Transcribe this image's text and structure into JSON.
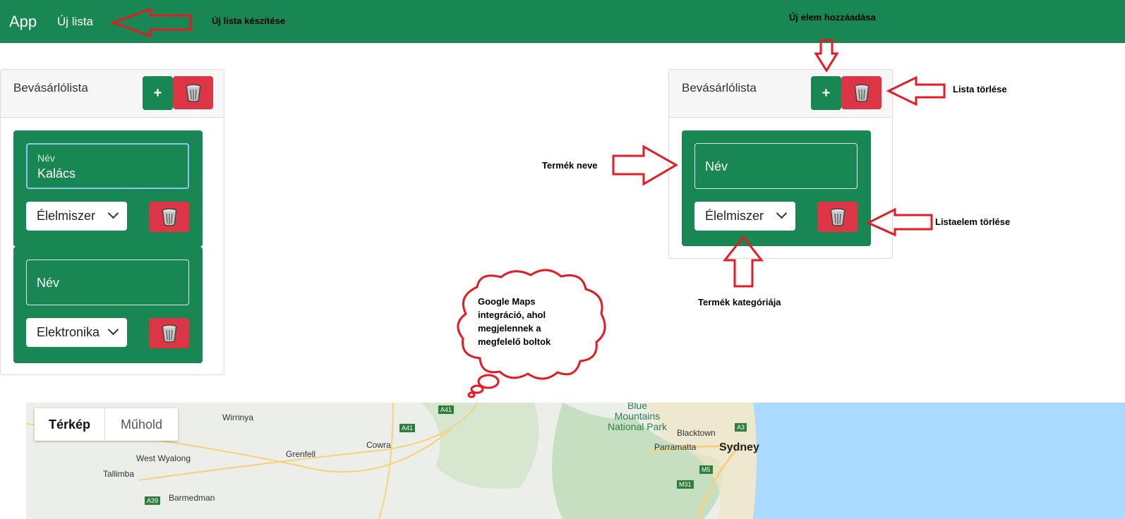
{
  "navbar": {
    "brand": "App",
    "new_list_link": "Új lista"
  },
  "lists": [
    {
      "title": "Bevásárlólista",
      "add_label": "+",
      "items": [
        {
          "name_label": "Név",
          "name_value": "Kalács",
          "category": "Élelmiszer"
        },
        {
          "name_placeholder": "Név",
          "category": "Elektronika"
        }
      ]
    },
    {
      "title": "Bevásárlólista",
      "add_label": "+",
      "items": [
        {
          "name_placeholder": "Név",
          "category": "Élelmiszer"
        }
      ]
    }
  ],
  "annotations": {
    "new_list": "Új lista készítése",
    "new_item": "Új elem hozzáadása",
    "delete_list": "Lista törlése",
    "product_name": "Termék neve",
    "delete_item": "Listaelem törlése",
    "product_category": "Termék kategóriája",
    "cloud_line1": "Google Maps",
    "cloud_line2": "integráció, ahol",
    "cloud_line3": "megjelennek a",
    "cloud_line4": "megfelelő boltok"
  },
  "map": {
    "tab_map": "Térkép",
    "tab_satellite": "Műhold",
    "places": {
      "p1": "Wirrinya",
      "p2": "Grenfell",
      "p3": "Cowra",
      "p4": "West Wyalong",
      "p5": "Tallimba",
      "p6": "Barmedman",
      "p7": "Blacktown",
      "p8": "Parramatta",
      "p9": "Sydney",
      "park1": "Blue",
      "park2": "Mountains",
      "park3": "National Park"
    },
    "roads": {
      "r1": "A41",
      "r2": "A41",
      "r3": "A39",
      "r4": "A3",
      "r5": "M5",
      "r6": "M31"
    }
  },
  "colors": {
    "brand_green": "#198754",
    "danger_red": "#dc3545",
    "annotation_red": "#e31b23",
    "water": "#aadaff"
  }
}
